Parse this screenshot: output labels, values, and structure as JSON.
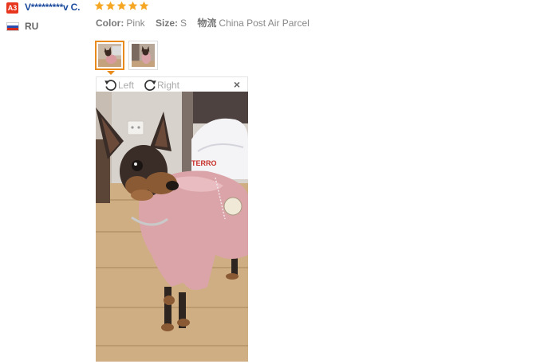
{
  "review": {
    "badge": "A3",
    "username": "V*********v C.",
    "rating": 5,
    "country": "RU",
    "attributes": [
      {
        "label": "Color:",
        "value": "Pink"
      },
      {
        "label": "Size:",
        "value": "S"
      },
      {
        "label": "物流",
        "value": "China Post Air Parcel"
      }
    ]
  },
  "viewer": {
    "rotate_left_label": "Left",
    "rotate_right_label": "Right",
    "close_label": "×",
    "selected_thumbnail": 1
  },
  "colors": {
    "badge": "#e8361e",
    "username": "#1a4a9c",
    "star": "#f5a623",
    "selected_border": "#e98a1d"
  },
  "icons": [
    "star-icon",
    "russia-flag-icon",
    "rotate-left-icon",
    "rotate-right-icon",
    "close-icon"
  ]
}
